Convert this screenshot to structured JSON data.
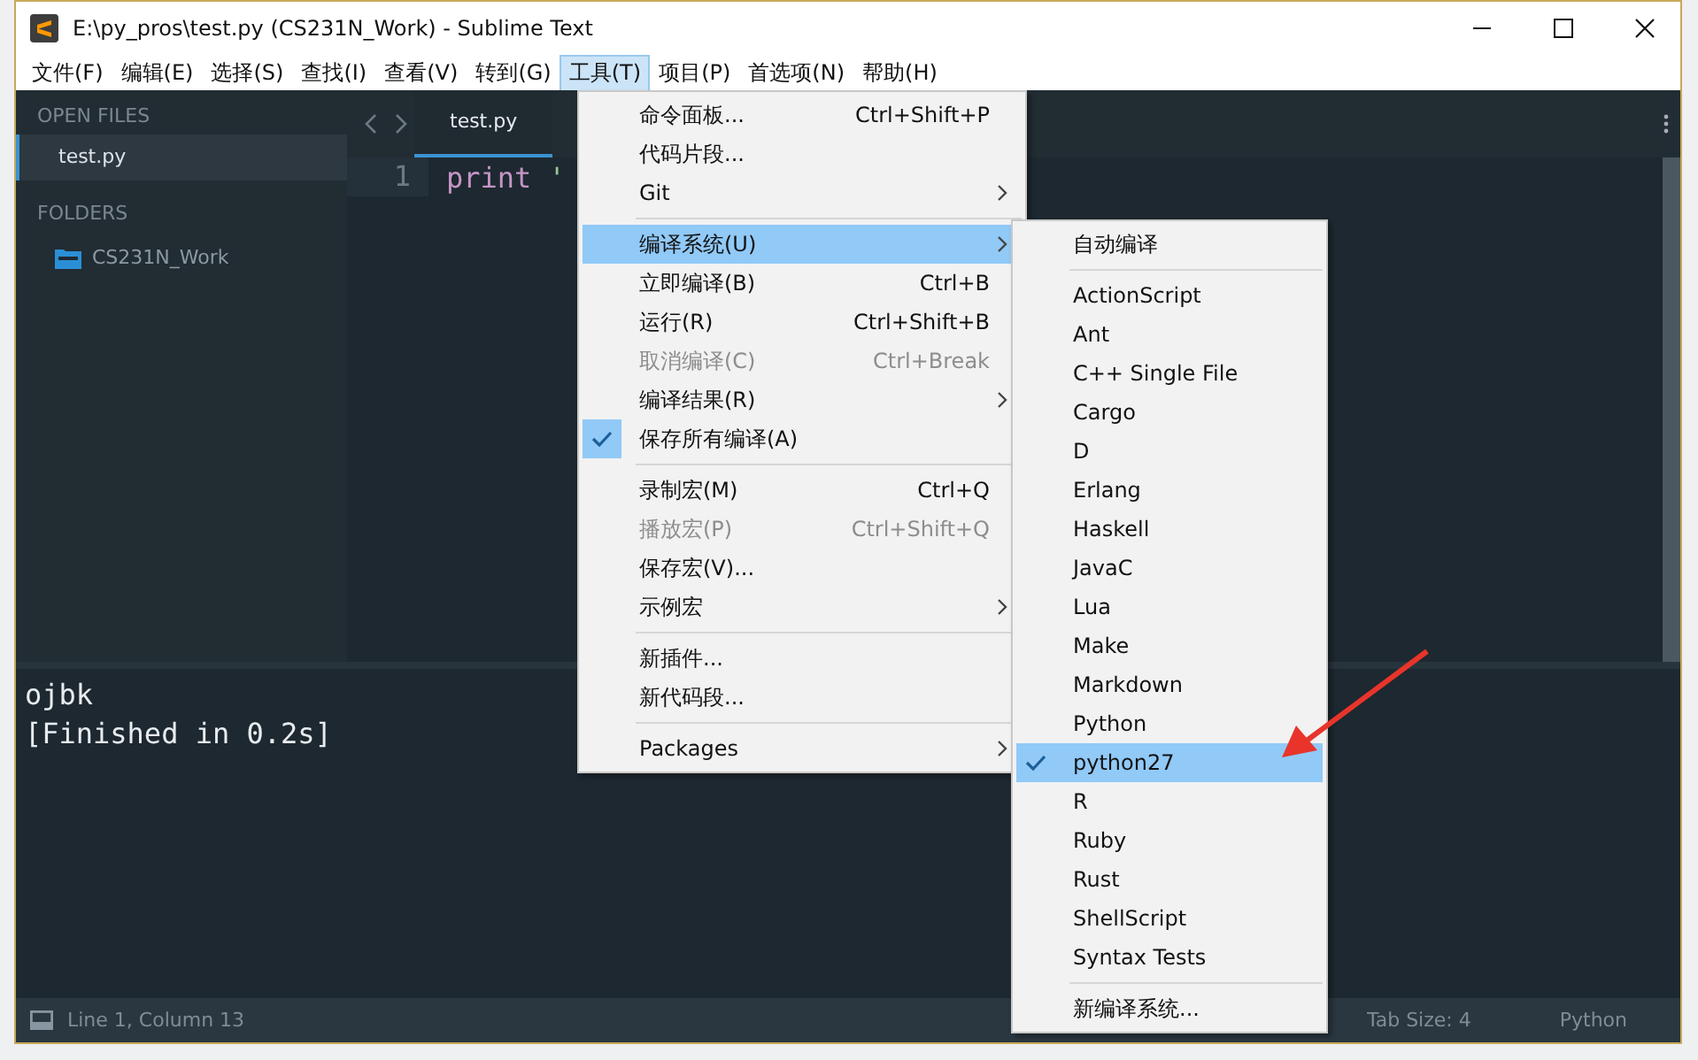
{
  "window": {
    "title": "E:\\py_pros\\test.py (CS231N_Work) - Sublime Text"
  },
  "menubar": [
    {
      "label": "文件(F)",
      "selected": false
    },
    {
      "label": "编辑(E)",
      "selected": false
    },
    {
      "label": "选择(S)",
      "selected": false
    },
    {
      "label": "查找(I)",
      "selected": false
    },
    {
      "label": "查看(V)",
      "selected": false
    },
    {
      "label": "转到(G)",
      "selected": false
    },
    {
      "label": "工具(T)",
      "selected": true
    },
    {
      "label": "项目(P)",
      "selected": false
    },
    {
      "label": "首选项(N)",
      "selected": false
    },
    {
      "label": "帮助(H)",
      "selected": false
    }
  ],
  "sidebar": {
    "open_files_heading": "OPEN FILES",
    "open_files": [
      {
        "label": "test.py",
        "selected": true
      }
    ],
    "folders_heading": "FOLDERS",
    "folders": [
      {
        "label": "CS231N_Work"
      }
    ]
  },
  "tabs": [
    {
      "label": "test.py",
      "selected": true
    }
  ],
  "editor": {
    "lines": [
      {
        "number": "1",
        "tokens": [
          {
            "text": "print",
            "kind": "keyword"
          },
          {
            "text": " '",
            "kind": "string"
          }
        ]
      }
    ]
  },
  "output": {
    "lines": [
      "ojbk",
      "[Finished in 0.2s]"
    ]
  },
  "status_bar": {
    "position": "Line 1, Column 13",
    "tab_size": "Tab Size: 4",
    "syntax": "Python"
  },
  "tools_menu": [
    {
      "kind": "item",
      "label": "命令面板...",
      "shortcut": "Ctrl+Shift+P",
      "disabled": false,
      "submenu": false,
      "checked": false,
      "selected": false
    },
    {
      "kind": "item",
      "label": "代码片段...",
      "disabled": false,
      "submenu": false,
      "checked": false,
      "selected": false
    },
    {
      "kind": "item",
      "label": "Git",
      "disabled": false,
      "submenu": true,
      "checked": false,
      "selected": false
    },
    {
      "kind": "separator"
    },
    {
      "kind": "item",
      "label": "编译系统(U)",
      "disabled": false,
      "submenu": true,
      "checked": false,
      "selected": true
    },
    {
      "kind": "item",
      "label": "立即编译(B)",
      "shortcut": "Ctrl+B",
      "disabled": false,
      "submenu": false,
      "checked": false,
      "selected": false
    },
    {
      "kind": "item",
      "label": "运行(R)",
      "shortcut": "Ctrl+Shift+B",
      "disabled": false,
      "submenu": false,
      "checked": false,
      "selected": false
    },
    {
      "kind": "item",
      "label": "取消编译(C)",
      "shortcut": "Ctrl+Break",
      "disabled": true,
      "submenu": false,
      "checked": false,
      "selected": false
    },
    {
      "kind": "item",
      "label": "编译结果(R)",
      "disabled": false,
      "submenu": true,
      "checked": false,
      "selected": false
    },
    {
      "kind": "item",
      "label": "保存所有编译(A)",
      "disabled": false,
      "submenu": false,
      "checked": true,
      "selected": false
    },
    {
      "kind": "separator"
    },
    {
      "kind": "item",
      "label": "录制宏(M)",
      "shortcut": "Ctrl+Q",
      "disabled": false,
      "submenu": false,
      "checked": false,
      "selected": false
    },
    {
      "kind": "item",
      "label": "播放宏(P)",
      "shortcut": "Ctrl+Shift+Q",
      "disabled": true,
      "submenu": false,
      "checked": false,
      "selected": false
    },
    {
      "kind": "item",
      "label": "保存宏(V)...",
      "disabled": false,
      "submenu": false,
      "checked": false,
      "selected": false
    },
    {
      "kind": "item",
      "label": "示例宏",
      "disabled": false,
      "submenu": true,
      "checked": false,
      "selected": false
    },
    {
      "kind": "separator"
    },
    {
      "kind": "item",
      "label": "新插件...",
      "disabled": false,
      "submenu": false,
      "checked": false,
      "selected": false
    },
    {
      "kind": "item",
      "label": "新代码段...",
      "disabled": false,
      "submenu": false,
      "checked": false,
      "selected": false
    },
    {
      "kind": "separator"
    },
    {
      "kind": "item",
      "label": "Packages",
      "disabled": false,
      "submenu": true,
      "checked": false,
      "selected": false
    }
  ],
  "build_system_menu": [
    {
      "kind": "item",
      "label": "自动编译",
      "checked": false,
      "selected": false
    },
    {
      "kind": "separator"
    },
    {
      "kind": "item",
      "label": "ActionScript",
      "checked": false,
      "selected": false
    },
    {
      "kind": "item",
      "label": "Ant",
      "checked": false,
      "selected": false
    },
    {
      "kind": "item",
      "label": "C++ Single File",
      "checked": false,
      "selected": false
    },
    {
      "kind": "item",
      "label": "Cargo",
      "checked": false,
      "selected": false
    },
    {
      "kind": "item",
      "label": "D",
      "checked": false,
      "selected": false
    },
    {
      "kind": "item",
      "label": "Erlang",
      "checked": false,
      "selected": false
    },
    {
      "kind": "item",
      "label": "Haskell",
      "checked": false,
      "selected": false
    },
    {
      "kind": "item",
      "label": "JavaC",
      "checked": false,
      "selected": false
    },
    {
      "kind": "item",
      "label": "Lua",
      "checked": false,
      "selected": false
    },
    {
      "kind": "item",
      "label": "Make",
      "checked": false,
      "selected": false
    },
    {
      "kind": "item",
      "label": "Markdown",
      "checked": false,
      "selected": false
    },
    {
      "kind": "item",
      "label": "Python",
      "checked": false,
      "selected": false
    },
    {
      "kind": "item",
      "label": "python27",
      "checked": true,
      "selected": true
    },
    {
      "kind": "item",
      "label": "R",
      "checked": false,
      "selected": false
    },
    {
      "kind": "item",
      "label": "Ruby",
      "checked": false,
      "selected": false
    },
    {
      "kind": "item",
      "label": "Rust",
      "checked": false,
      "selected": false
    },
    {
      "kind": "item",
      "label": "ShellScript",
      "checked": false,
      "selected": false
    },
    {
      "kind": "item",
      "label": "Syntax Tests",
      "checked": false,
      "selected": false
    },
    {
      "kind": "separator"
    },
    {
      "kind": "item",
      "label": "新编译系统...",
      "checked": false,
      "selected": false
    }
  ]
}
